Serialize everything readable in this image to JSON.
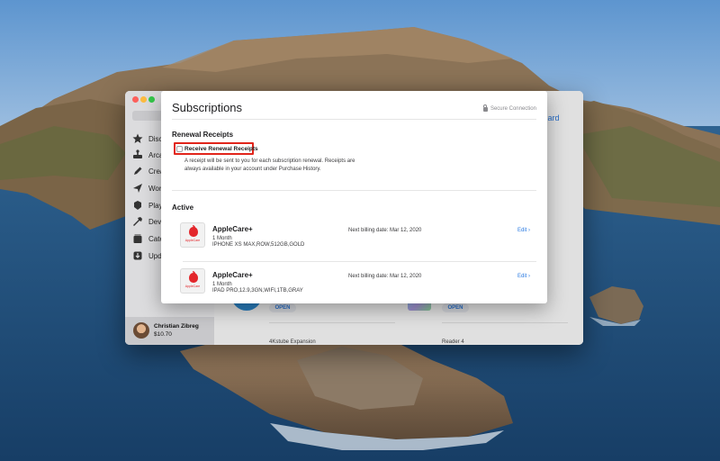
{
  "appstore": {
    "sidebar": {
      "search_placeholder": "Q",
      "items": [
        {
          "label": "Disc",
          "icon": "star-icon"
        },
        {
          "label": "Arca",
          "icon": "arcade-icon"
        },
        {
          "label": "Crea",
          "icon": "create-icon"
        },
        {
          "label": "Wor",
          "icon": "work-icon"
        },
        {
          "label": "Play",
          "icon": "play-icon"
        },
        {
          "label": "Dev",
          "icon": "develop-icon"
        },
        {
          "label": "Cate",
          "icon": "categories-icon"
        },
        {
          "label": "Upd",
          "icon": "updates-icon"
        }
      ],
      "account": {
        "name": "Christian Zibreg",
        "balance": "$10.70"
      }
    },
    "background": {
      "link_fragment": "t Card",
      "open_label_1": "OPEN",
      "open_label_2": "OPEN",
      "text_left": "4Kstube Expansion",
      "text_right": "Reader 4"
    }
  },
  "sheet": {
    "title": "Subscriptions",
    "secure_connection": "Secure Connection",
    "renewal": {
      "heading": "Renewal Receipts",
      "checkbox_label": "Receive Renewal Receipts",
      "checked": false,
      "description": "A receipt will be sent to you for each subscription renewal. Receipts are always available in your account under Purchase History."
    },
    "active": {
      "heading": "Active",
      "items": [
        {
          "name": "AppleCare+",
          "icon_brand": "AppleCare",
          "period": "1 Month",
          "device": "IPHONE XS MAX,ROW,512GB,GOLD",
          "billing": "Next billing date: Mar 12, 2020",
          "edit": "Edit ›"
        },
        {
          "name": "AppleCare+",
          "icon_brand": "AppleCare",
          "period": "1 Month",
          "device": "IPAD PRO,12.9,3GN,WIFI,1TB,GRAY",
          "billing": "Next billing date: Mar 12, 2020",
          "edit": "Edit ›"
        }
      ]
    }
  },
  "colors": {
    "accent": "#2a7ae2",
    "highlight": "#e1251b",
    "applecare_red": "#e3262b"
  }
}
